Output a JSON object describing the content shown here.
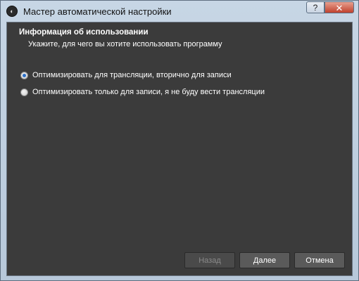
{
  "window": {
    "title": "Мастер автоматической настройки",
    "help_label": "?",
    "close_label": "✕"
  },
  "page": {
    "title": "Информация об использовании",
    "subtitle": "Укажите, для чего вы хотите использовать программу"
  },
  "options": [
    {
      "label": "Оптимизировать для трансляции, вторично для записи",
      "selected": true
    },
    {
      "label": "Оптимизировать только для записи, я не буду вести трансляции",
      "selected": false
    }
  ],
  "buttons": {
    "back": "Назад",
    "next": "Далее",
    "cancel": "Отмена"
  },
  "colors": {
    "content_bg": "#3b3b3b",
    "button_bg": "#5a5a5a",
    "radio_accent": "#2a6fc9"
  }
}
